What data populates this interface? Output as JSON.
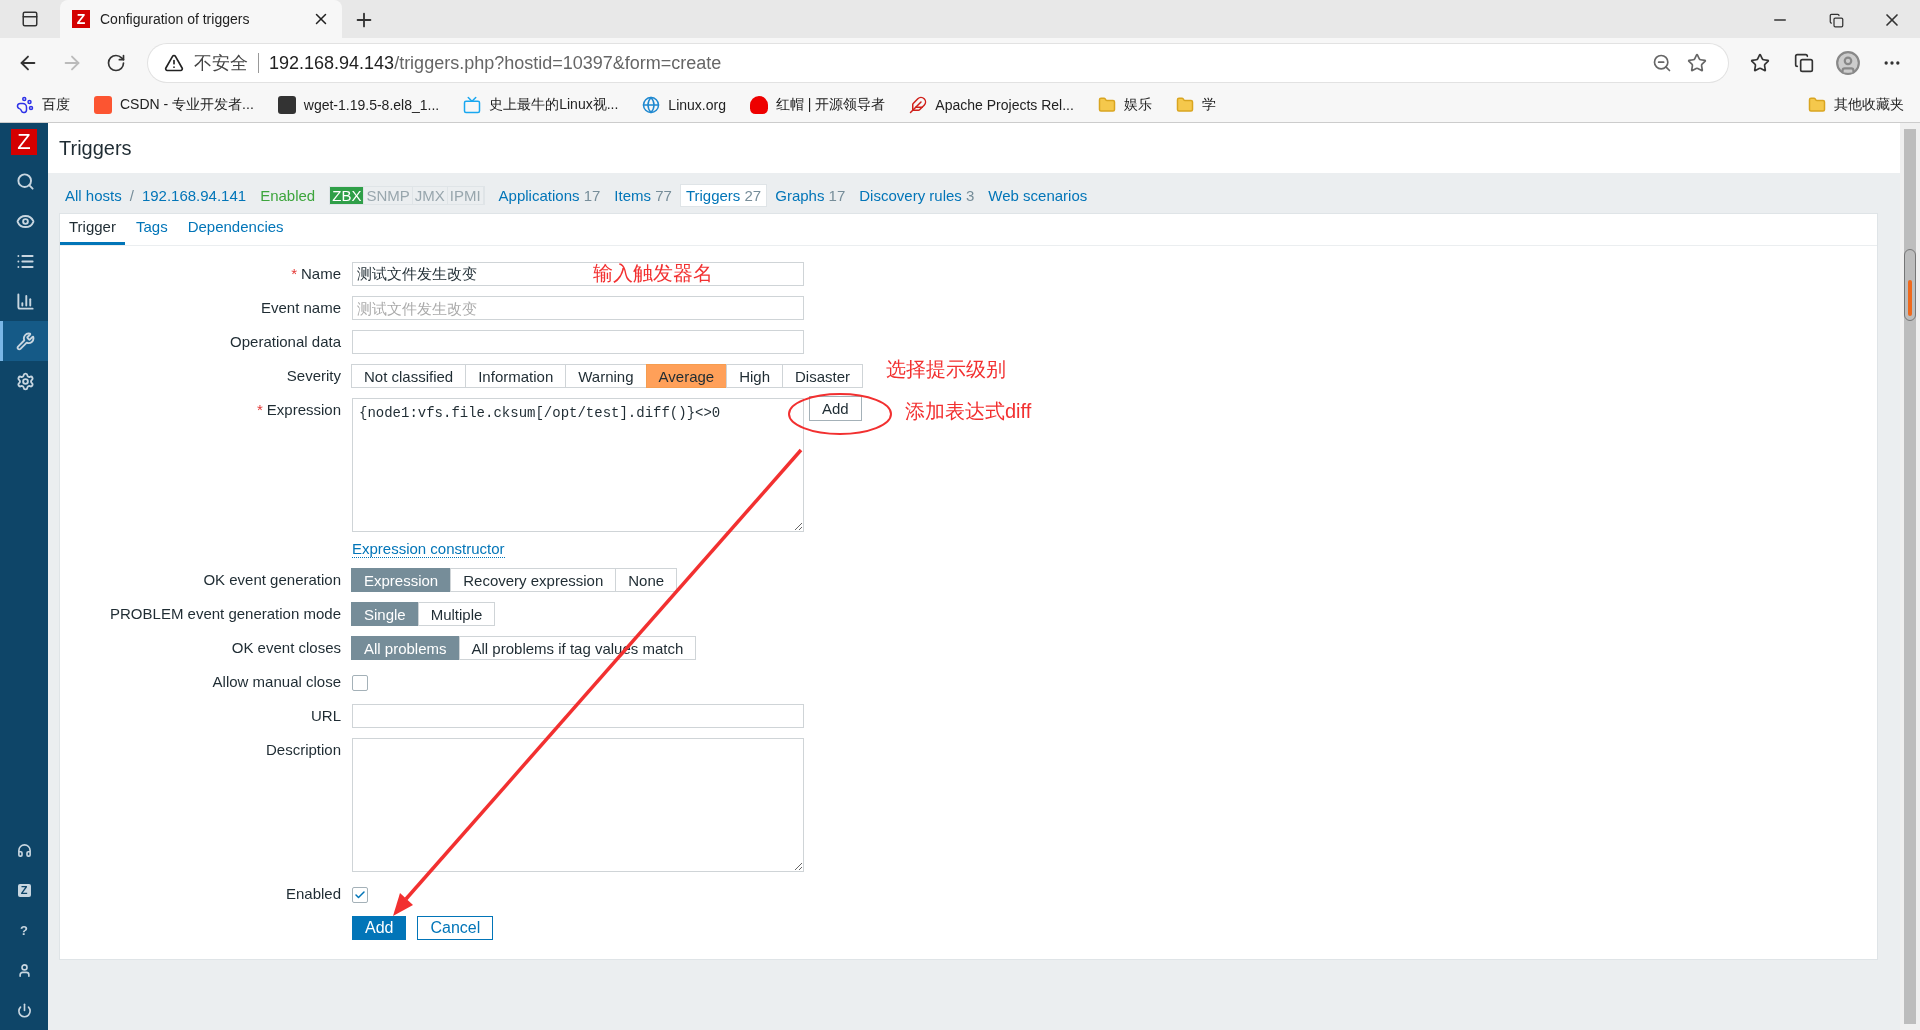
{
  "browser": {
    "favicon": "Z",
    "tab_title": "Configuration of triggers",
    "security_label": "不安全",
    "url_host": "192.168.94.143",
    "url_path": "/triggers.php?hostid=10397&form=create",
    "bookmarks": [
      {
        "kind": "paw",
        "label": "百度"
      },
      {
        "kind": "orange",
        "label": "CSDN - 专业开发者..."
      },
      {
        "kind": "search",
        "label": "wget-1.19.5-8.el8_1..."
      },
      {
        "kind": "tv",
        "label": "史上最牛的Linux视..."
      },
      {
        "kind": "globe",
        "label": "Linux.org"
      },
      {
        "kind": "hat",
        "label": "红帽 | 开源领导者"
      },
      {
        "kind": "feather",
        "label": "Apache Projects Rel..."
      },
      {
        "kind": "folder",
        "label": "娱乐"
      },
      {
        "kind": "folder",
        "label": "学"
      }
    ],
    "other_bookmarks": "其他收藏夹"
  },
  "sidebar": {
    "logo": "Z",
    "items": [
      {
        "kind": "search",
        "selected": false
      },
      {
        "kind": "eye",
        "selected": false
      },
      {
        "kind": "list",
        "selected": false
      },
      {
        "kind": "chart",
        "selected": false
      },
      {
        "kind": "wrench",
        "selected": true
      },
      {
        "kind": "gear",
        "selected": false
      }
    ],
    "bottom": [
      {
        "kind": "support"
      },
      {
        "kind": "share",
        "text": "Z"
      },
      {
        "kind": "help",
        "text": "?"
      },
      {
        "kind": "user"
      },
      {
        "kind": "power"
      }
    ]
  },
  "page_title": "Triggers",
  "host_nav": {
    "breadcrumbs": [
      "All hosts",
      "192.168.94.141"
    ],
    "separator": "/",
    "status": "Enabled",
    "availability": [
      {
        "label": "ZBX",
        "on": true
      },
      {
        "label": "SNMP",
        "on": false
      },
      {
        "label": "JMX",
        "on": false
      },
      {
        "label": "IPMI",
        "on": false
      }
    ],
    "links": [
      {
        "label": "Applications",
        "count": "17",
        "selected": false
      },
      {
        "label": "Items",
        "count": "77",
        "selected": false
      },
      {
        "label": "Triggers",
        "count": "27",
        "selected": true
      },
      {
        "label": "Graphs",
        "count": "17",
        "selected": false
      },
      {
        "label": "Discovery rules",
        "count": "3",
        "selected": false
      },
      {
        "label": "Web scenarios",
        "selected": false
      }
    ]
  },
  "tabs": [
    {
      "label": "Trigger",
      "selected": true
    },
    {
      "label": "Tags",
      "selected": false
    },
    {
      "label": "Dependencies",
      "selected": false
    }
  ],
  "form": {
    "required_mark": "*",
    "rows": [
      {
        "kind": "text",
        "label": "Name",
        "required": true,
        "value": "测试文件发生改变"
      },
      {
        "kind": "text",
        "label": "Event name",
        "required": false,
        "placeholder": "测试文件发生改变"
      },
      {
        "kind": "text",
        "label": "Operational data",
        "required": false
      },
      {
        "kind": "segmented",
        "label": "Severity",
        "options": [
          {
            "label": "Not classified",
            "selected": false
          },
          {
            "label": "Information",
            "selected": false
          },
          {
            "label": "Warning",
            "selected": false
          },
          {
            "label": "Average",
            "selected": true
          },
          {
            "label": "High",
            "selected": false
          },
          {
            "label": "Disaster",
            "selected": false
          }
        ]
      },
      {
        "kind": "expression",
        "label": "Expression",
        "required": true,
        "value": "{node1:vfs.file.cksum[/opt/test].diff()}<>0",
        "button": "Add"
      },
      {
        "kind": "link",
        "text": "Expression constructor"
      },
      {
        "kind": "segmented",
        "label": "OK event generation",
        "options": [
          {
            "label": "Expression",
            "selected": true
          },
          {
            "label": "Recovery expression",
            "selected": false
          },
          {
            "label": "None",
            "selected": false
          }
        ]
      },
      {
        "kind": "segmented",
        "label": "PROBLEM event generation mode",
        "options": [
          {
            "label": "Single",
            "selected": true
          },
          {
            "label": "Multiple",
            "selected": false
          }
        ]
      },
      {
        "kind": "segmented",
        "label": "OK event closes",
        "options": [
          {
            "label": "All problems",
            "selected": true
          },
          {
            "label": "All problems if tag values match",
            "selected": false
          }
        ]
      },
      {
        "kind": "checkbox",
        "label": "Allow manual close",
        "checked": false
      },
      {
        "kind": "text",
        "label": "URL",
        "required": false
      },
      {
        "kind": "textarea",
        "label": "Description"
      },
      {
        "kind": "checkbox",
        "label": "Enabled",
        "checked": true
      }
    ],
    "buttons": [
      {
        "label": "Add",
        "primary": true
      },
      {
        "label": "Cancel",
        "primary": false
      }
    ]
  },
  "annotations": [
    {
      "text": "输入触发器名"
    },
    {
      "text": "选择提示级别"
    },
    {
      "text": "添加表达式diff"
    }
  ]
}
